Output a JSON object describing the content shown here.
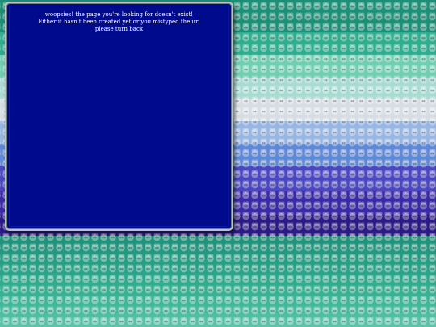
{
  "message": {
    "line1": "woopsies! the page you're looking for doesn't exist!",
    "line2": "Either it hasn't been created yet or you mistyped the url",
    "line3": "please turn back"
  },
  "colors": {
    "window_bg": "#000a8c",
    "window_border": "#b9c4c9",
    "text": "#ffffff",
    "pattern_teal": "#1e9e7e",
    "pattern_mint": "#72d3b0",
    "pattern_white": "#dfe7ea",
    "pattern_blue": "#5c94d6",
    "pattern_indigo": "#4a3fb2",
    "pattern_purple": "#2f1b85"
  },
  "background": {
    "motif": "cat-face-icon"
  }
}
